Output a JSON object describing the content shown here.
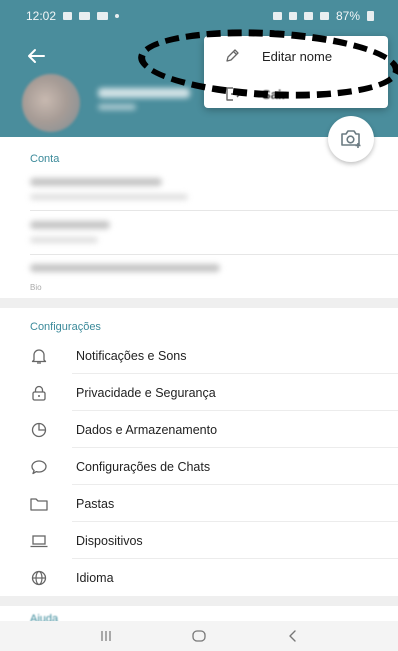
{
  "status_bar": {
    "time": "12:02",
    "battery": "87%"
  },
  "menu": {
    "edit_name": "Editar nome",
    "logout": "Sair"
  },
  "sections": {
    "account_title": "Conta",
    "bio_label": "Bio",
    "settings_title": "Configurações",
    "help_title": "Ajuda"
  },
  "settings_items": [
    {
      "label": "Notificações e Sons",
      "icon": "bell-icon"
    },
    {
      "label": "Privacidade e Segurança",
      "icon": "lock-icon"
    },
    {
      "label": "Dados e Armazenamento",
      "icon": "pie-chart-icon"
    },
    {
      "label": "Configurações de Chats",
      "icon": "chat-bubble-icon"
    },
    {
      "label": "Pastas",
      "icon": "folder-icon"
    },
    {
      "label": "Dispositivos",
      "icon": "laptop-icon"
    },
    {
      "label": "Idioma",
      "icon": "globe-icon"
    }
  ],
  "colors": {
    "header": "#4a8d9c",
    "accent": "#3b8a9a",
    "annotation": "#000000"
  },
  "nav_icons": [
    "recent-apps-icon",
    "home-icon",
    "back-nav-icon"
  ]
}
